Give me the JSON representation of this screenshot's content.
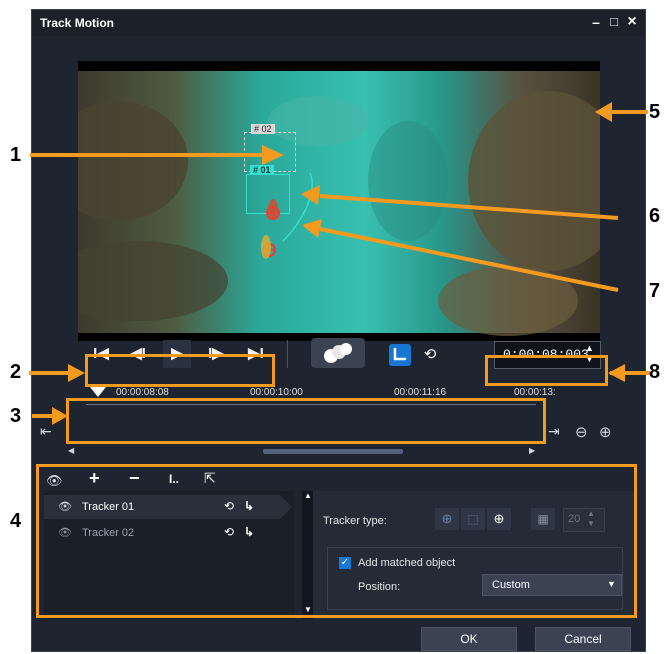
{
  "window": {
    "title": "Track Motion"
  },
  "window_controls": {
    "minimize": "–",
    "maximize": "□",
    "close": "×"
  },
  "transport": {
    "start": "I◀",
    "prev_frame": "◀I",
    "play": "▶",
    "next_frame": "I▶",
    "end": "▶I"
  },
  "timecode": "0:00:08:003",
  "timeline": {
    "ticks": [
      "00:00:08:08",
      "00:00:10:00",
      "00:00:11:16",
      "00:00:13:"
    ]
  },
  "trackers": [
    {
      "label": "Tracker 01"
    },
    {
      "label": "Tracker 02"
    }
  ],
  "video_labels": {
    "tracker_box_1": "# 01",
    "tracker_box_2": "# 02"
  },
  "properties": {
    "tracker_type_label": "Tracker type:",
    "size_value": "20",
    "add_matched_object_label": "Add matched object",
    "add_matched_object_checked": true,
    "position_label": "Position:",
    "position_value": "Custom"
  },
  "footer": {
    "ok_label": "OK",
    "cancel_label": "Cancel"
  },
  "callouts": [
    "1",
    "2",
    "3",
    "4",
    "5",
    "6",
    "7",
    "8"
  ],
  "colors": {
    "accent": "#f39a1f",
    "window_bg": "#1f2530",
    "selected_row": "#242a34",
    "blue_btn": "#1976d2"
  }
}
